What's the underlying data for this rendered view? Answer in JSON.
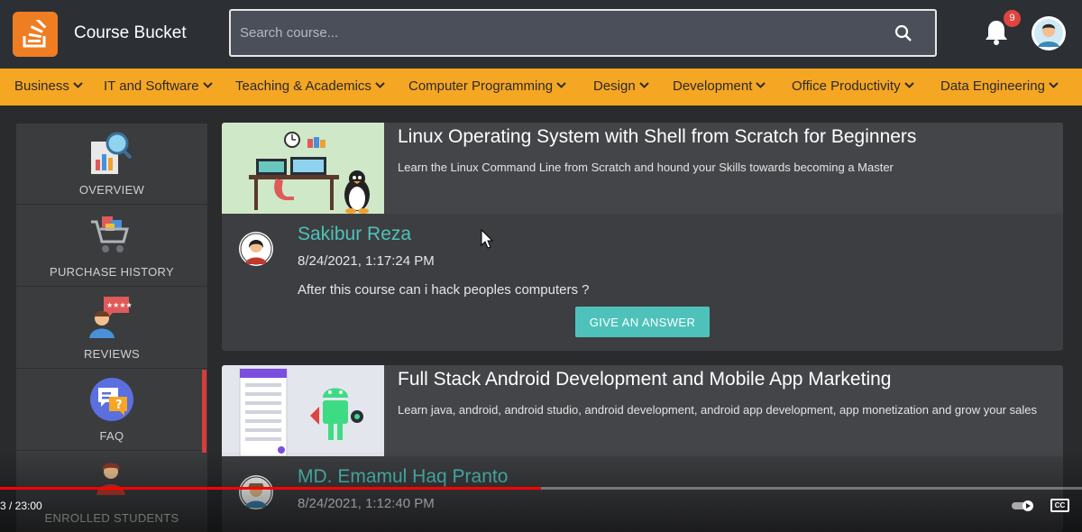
{
  "header": {
    "app_title": "Course Bucket",
    "search_placeholder": "Search course...",
    "notification_count": "9"
  },
  "categories": [
    {
      "label": "Business"
    },
    {
      "label": "IT and Software"
    },
    {
      "label": "Teaching & Academics"
    },
    {
      "label": "Computer Programming"
    },
    {
      "label": "Design"
    },
    {
      "label": "Development"
    },
    {
      "label": "Office Productivity"
    },
    {
      "label": "Data Engineering"
    }
  ],
  "sidebar": {
    "items": [
      {
        "label": "OVERVIEW",
        "icon": "overview-icon"
      },
      {
        "label": "PURCHASE HISTORY",
        "icon": "shopping-cart-icon"
      },
      {
        "label": "REVIEWS",
        "icon": "reviews-icon"
      },
      {
        "label": "FAQ",
        "icon": "faq-icon"
      },
      {
        "label": "ENROLLED STUDENTS",
        "icon": "students-icon"
      }
    ],
    "active": "FAQ"
  },
  "courses": [
    {
      "title": "Linux Operating System with Shell from Scratch for Beginners",
      "description": "Learn the Linux Command Line from Scratch and hound your Skills towards becoming a Master",
      "question": {
        "author": "Sakibur Reza",
        "date": "8/24/2021, 1:17:24 PM",
        "text": "After this course can i hack peoples computers ?",
        "button_label": "GIVE AN ANSWER"
      }
    },
    {
      "title": "Full Stack Android Development and Mobile App Marketing",
      "description": "Learn java, android, android studio, android development, android app development, app monetization and grow your sales",
      "question": {
        "author": "MD. Emamul Haq Pranto",
        "date": "8/24/2021, 1:12:40 PM"
      }
    }
  ],
  "video": {
    "time": "3 / 23:00",
    "progress": 0.5,
    "cc_label": "CC"
  },
  "colors": {
    "brand": "#ef7d22",
    "category_bar": "#f5a623",
    "accent_teal": "#4ec2ba",
    "badge": "#e0443e"
  }
}
